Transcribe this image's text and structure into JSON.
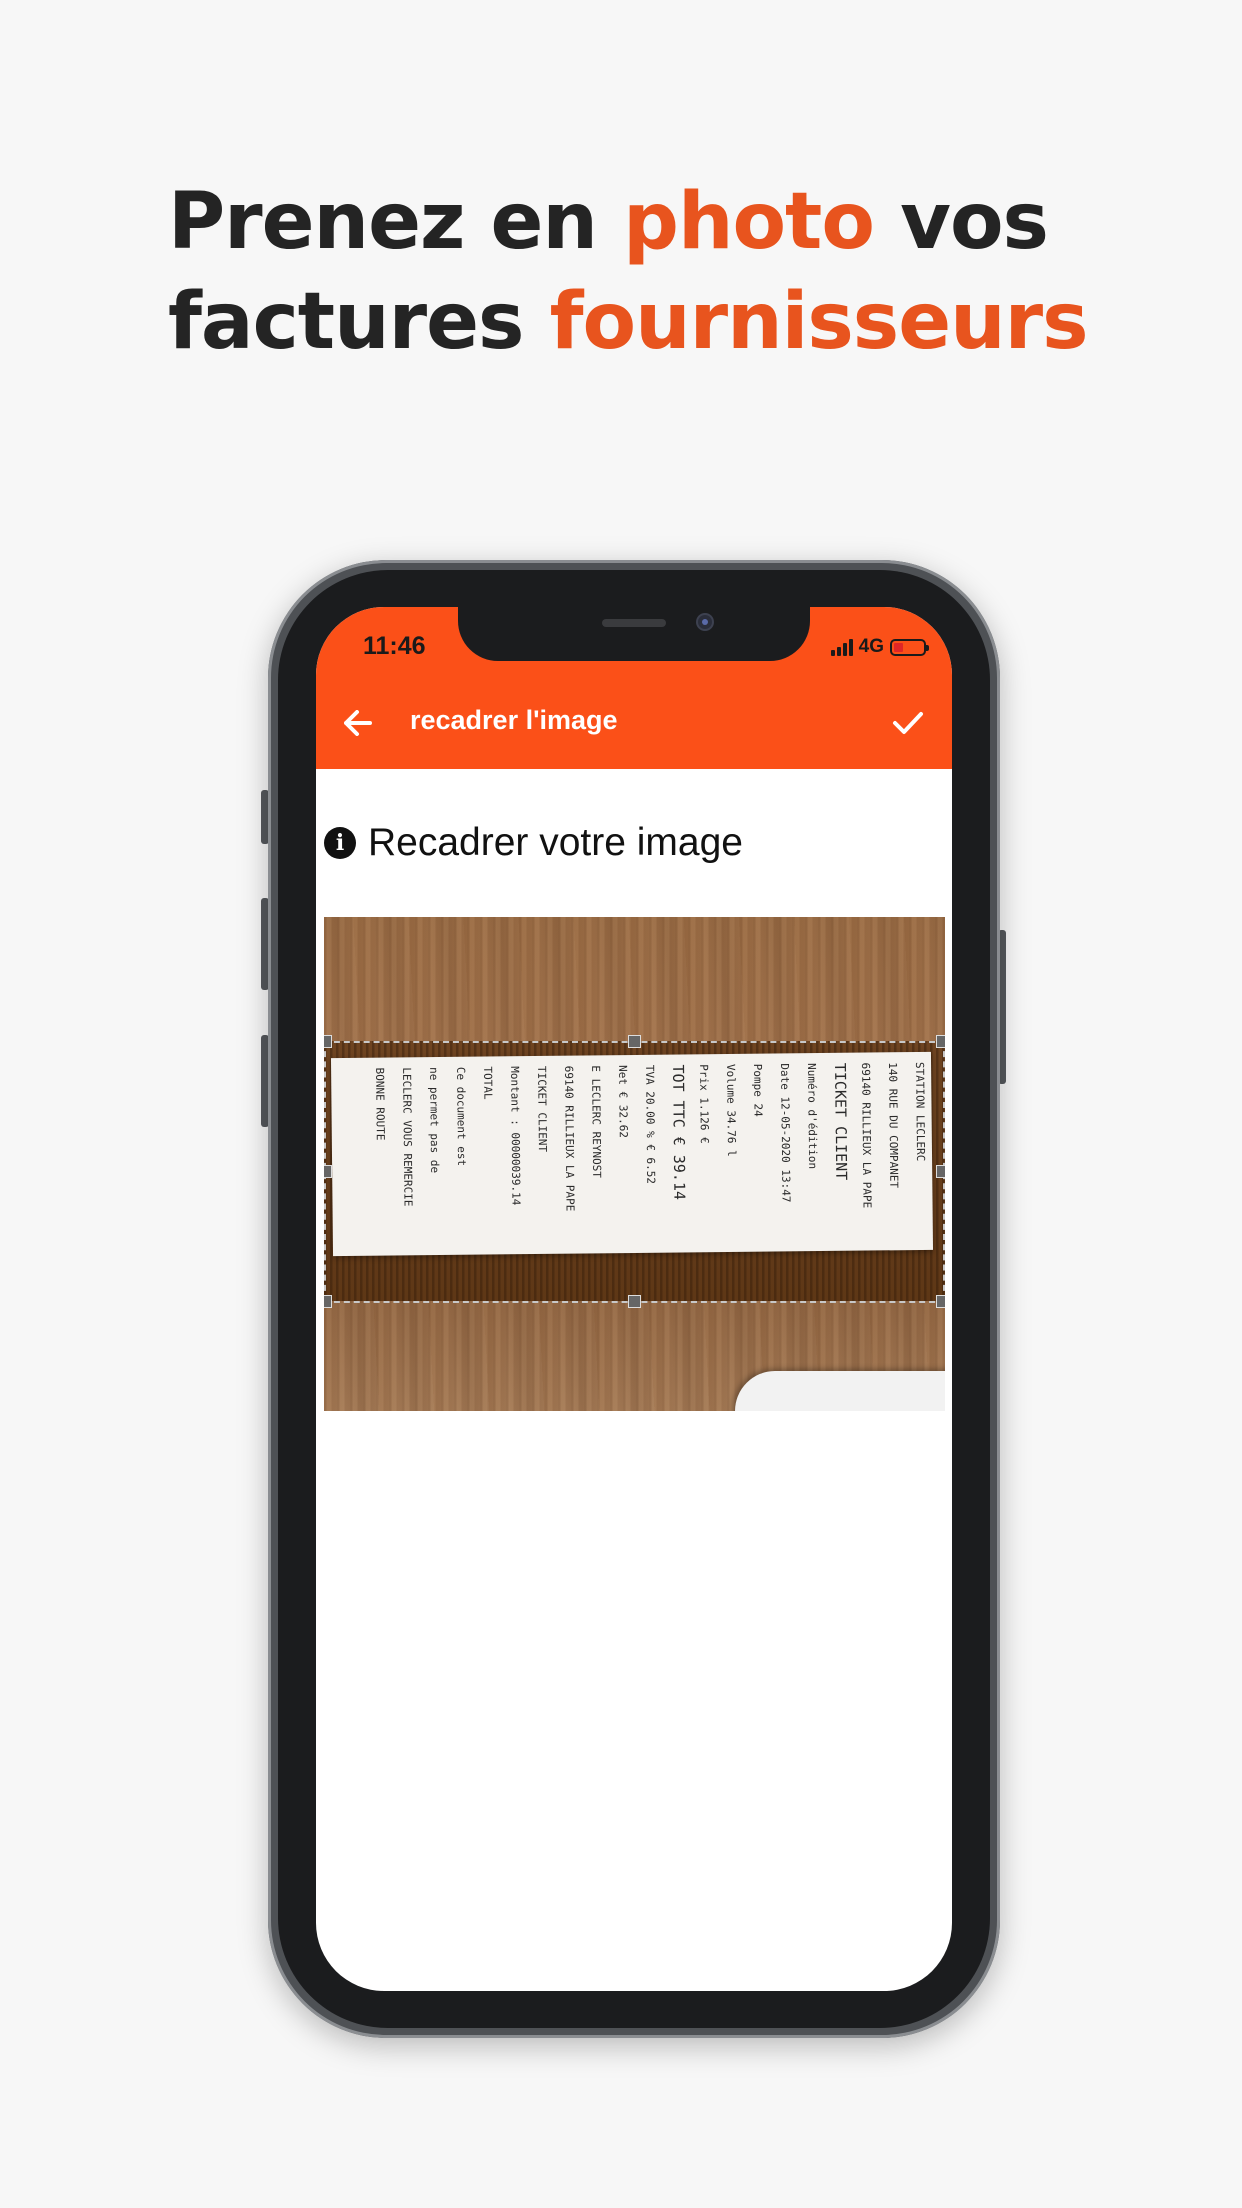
{
  "headline": {
    "line1_a": "Prenez en ",
    "line1_b": "photo",
    "line1_c": " vos",
    "line2_a": "factures ",
    "line2_b": "fournisseurs"
  },
  "colors": {
    "accent": "#e8541e",
    "appbar": "#fb5018",
    "headline_text": "#242424"
  },
  "status_bar": {
    "time": "11:46",
    "network": "4G"
  },
  "appbar": {
    "back_icon": "arrow-left-icon",
    "title": "recadrer l'image",
    "confirm_icon": "check-icon"
  },
  "content": {
    "info_icon": "info-icon",
    "info_glyph": "i",
    "instruction": "Recadrer votre image"
  },
  "receipt_text": [
    "STATION LECLERC",
    "140 RUE DU COMPANET",
    "69140 RILLIEUX LA PAPE",
    "TICKET CLIENT",
    "Numéro d'édition",
    "Date 12-05-2020 13:47",
    "Pompe 24",
    "Volume 34.76 l",
    "Prix 1.126 €",
    "TOT TTC € 39.14",
    "TVA 20.00 % € 6.52",
    "Net € 32.62",
    "E LECLERC REYNOST",
    "69140 RILLIEUX LA PAPE",
    "TICKET CLIENT",
    "Montant : 00000039.14",
    "TOTAL",
    "Ce document est",
    "ne permet pas de",
    "LECLERC VOUS REMERCIE",
    "BONNE ROUTE"
  ]
}
